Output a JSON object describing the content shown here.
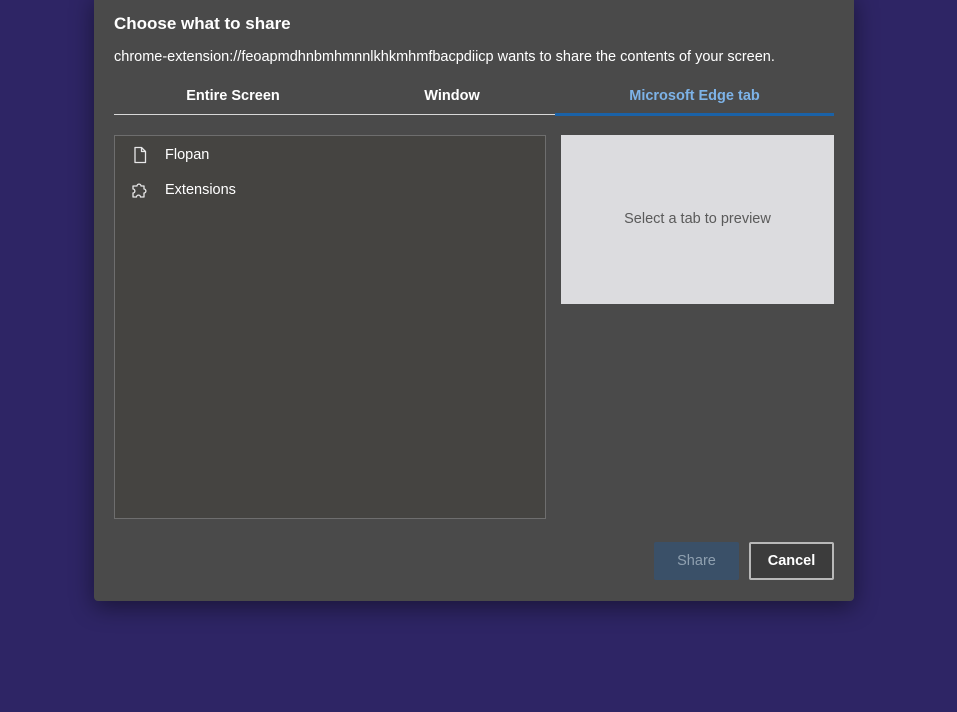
{
  "dialog": {
    "title": "Choose what to share",
    "subtitle": "chrome-extension://feoapmdhnbmhmnnlkhkmhmfbacpdiicp wants to share the contents of your screen."
  },
  "tabs": [
    {
      "label": "Entire Screen",
      "active": false
    },
    {
      "label": "Window",
      "active": false
    },
    {
      "label": "Microsoft Edge tab",
      "active": true
    }
  ],
  "tab_list": [
    {
      "label": "Flopan",
      "icon": "page-icon"
    },
    {
      "label": "Extensions",
      "icon": "puzzle-icon"
    }
  ],
  "preview": {
    "placeholder": "Select a tab to preview"
  },
  "buttons": {
    "share_label": "Share",
    "cancel_label": "Cancel"
  },
  "colors": {
    "background": "#2e2565",
    "dialog": "#4a4a4a",
    "active_tab_text": "#7db3e8",
    "active_tab_underline": "#1a62a8",
    "share_disabled": "#3a5068"
  }
}
